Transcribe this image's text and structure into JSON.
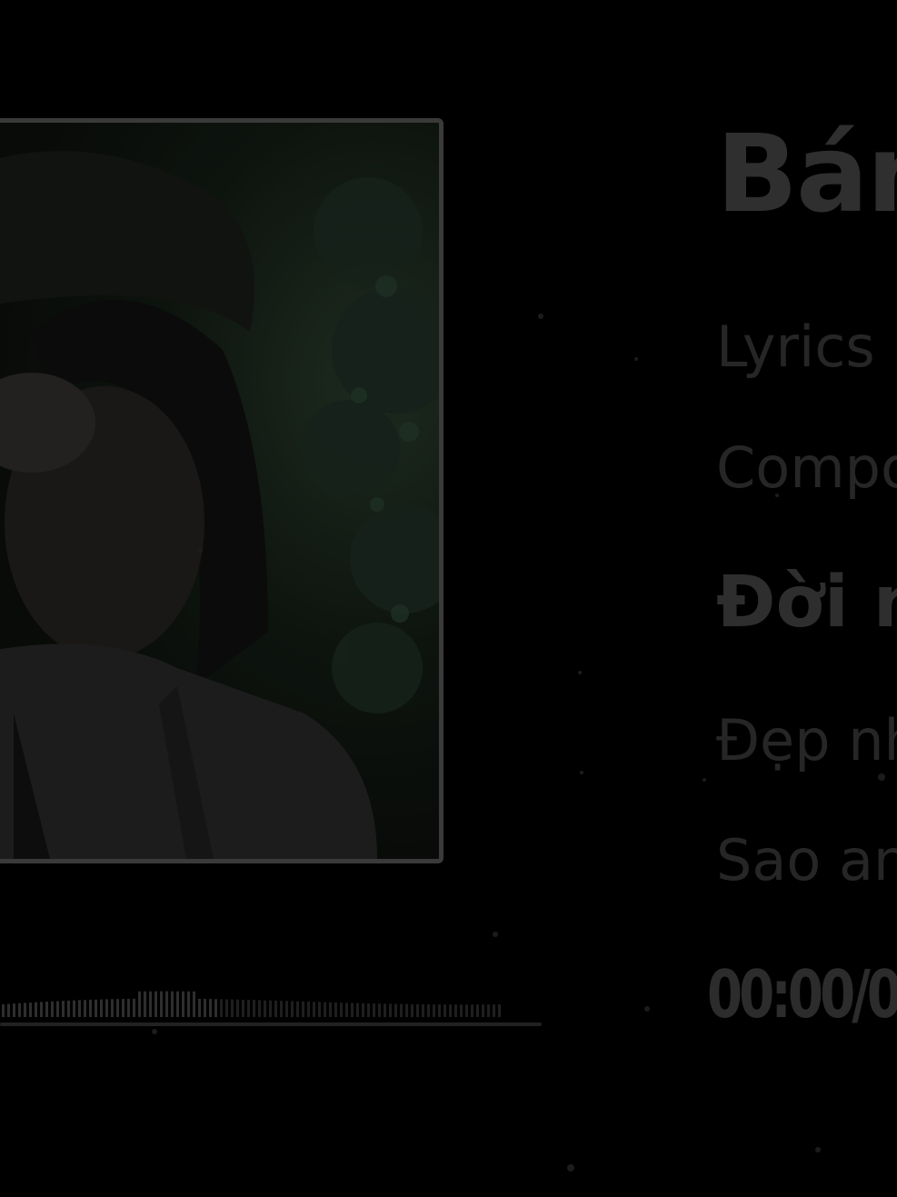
{
  "track": {
    "title": "Bán",
    "lines": [
      "Lyrics B",
      "Compo",
      "Đời n",
      "Đẹp nh",
      "Sao an"
    ],
    "active_line_index": 2
  },
  "player": {
    "time_display": "00:00/0",
    "progress": 0
  },
  "colors": {
    "background": "#000000",
    "text_dim": "#262626",
    "frame": "#3a3a3a"
  },
  "icons": [
    "album-cover-image",
    "waveform-visualizer"
  ]
}
